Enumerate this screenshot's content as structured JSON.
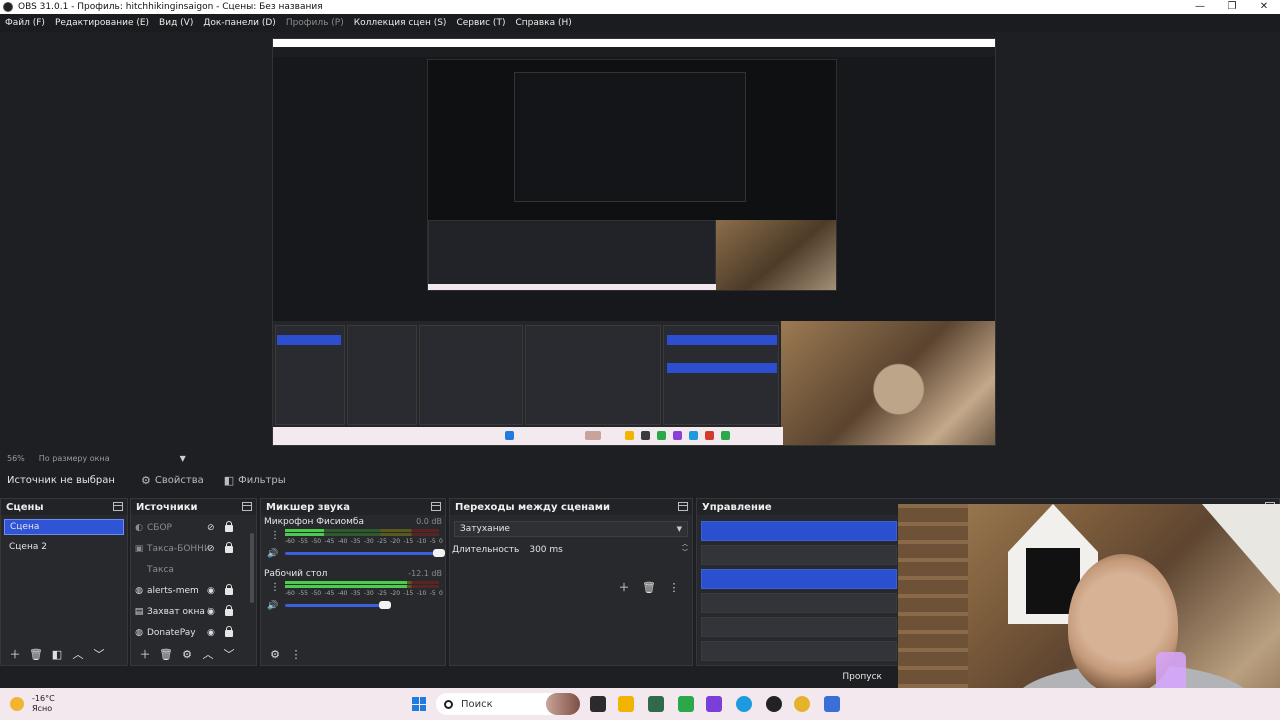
{
  "window": {
    "title": "OBS 31.0.1 - Профиль: hitchhikinginsaigon - Сцены: Без названия"
  },
  "menu": [
    {
      "label": "Файл (F)",
      "disabled": false
    },
    {
      "label": "Редактирование (E)",
      "disabled": false
    },
    {
      "label": "Вид (V)",
      "disabled": false
    },
    {
      "label": "Док-панели (D)",
      "disabled": false
    },
    {
      "label": "Профиль (P)",
      "disabled": true
    },
    {
      "label": "Коллекция сцен (S)",
      "disabled": false
    },
    {
      "label": "Сервис (T)",
      "disabled": false
    },
    {
      "label": "Справка (H)",
      "disabled": false
    }
  ],
  "preview": {
    "zoom": "56%",
    "zoom_mode": "По размеру окна"
  },
  "propbar": {
    "no_source": "Источник не выбран",
    "properties": "Свойства",
    "filters": "Фильтры"
  },
  "scenes": {
    "title": "Сцены",
    "items": [
      "Сцена",
      "Сцена 2"
    ],
    "active": 0
  },
  "sources": {
    "title": "Источники",
    "items": [
      {
        "name": "СБОР",
        "icon": "scene-icon",
        "visible": false
      },
      {
        "name": "Такса-БОННИ",
        "icon": "image-icon",
        "visible": false
      },
      {
        "name": "Такса",
        "icon": "image-icon",
        "visible": false
      },
      {
        "name": "alerts-mem",
        "icon": "globe-icon",
        "visible": true
      },
      {
        "name": "Захват окна Di",
        "icon": "window-icon",
        "visible": true
      },
      {
        "name": "DonatePay",
        "icon": "globe-icon",
        "visible": true
      }
    ]
  },
  "mixer": {
    "title": "Микшер звука",
    "channels": [
      {
        "name": "Микрофон Фисиомба",
        "db": "0.0 dB",
        "level": 0.25,
        "volume": 1.0
      },
      {
        "name": "Рабочий стол",
        "db": "-12.1 dB",
        "level": 0.79,
        "volume": 0.65
      }
    ],
    "ticks": [
      "-60",
      "-55",
      "-50",
      "-45",
      "-40",
      "-35",
      "-30",
      "-25",
      "-20",
      "-15",
      "-10",
      "-5",
      "0"
    ]
  },
  "transitions": {
    "title": "Переходы между сценами",
    "selected": "Затухание",
    "duration_label": "Длительность",
    "duration": "300 ms"
  },
  "controls": {
    "title": "Управление",
    "studio_mode": "Пропуск"
  },
  "taskbar": {
    "temperature": "-16°C",
    "weather": "Ясно",
    "search": "Поиск"
  },
  "colors": {
    "accent": "#2f54d6",
    "meter_green": "#4ccc4c",
    "taskbar": "#f2e8ee"
  }
}
